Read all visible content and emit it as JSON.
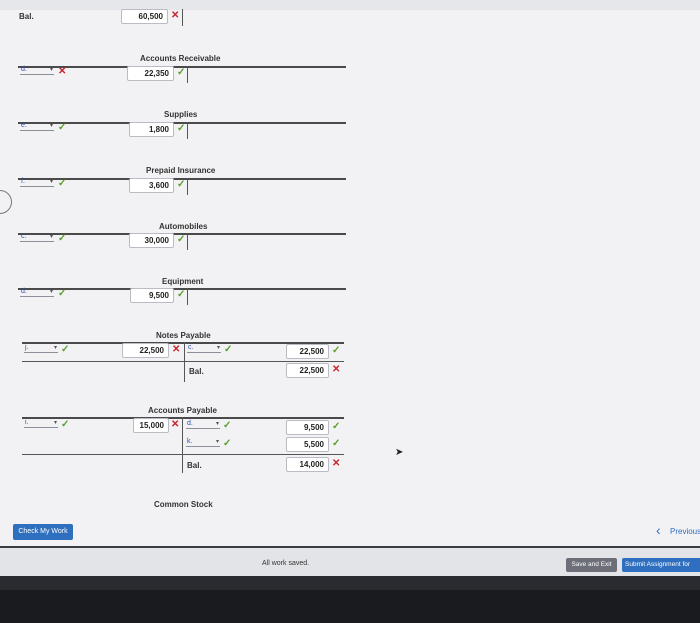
{
  "top": {
    "label": "Bal.",
    "value": "60,500"
  },
  "accounts": [
    {
      "title": "Accounts Receivable",
      "sel": "d.",
      "sel_mark": "✕",
      "value": "22,350",
      "val_mark": "✓"
    },
    {
      "title": "Supplies",
      "sel": "e.",
      "sel_mark": "✓",
      "value": "1,800",
      "val_mark": "✓"
    },
    {
      "title": "Prepaid Insurance",
      "sel": "f.",
      "sel_mark": "✓",
      "value": "3,600",
      "val_mark": "✓"
    },
    {
      "title": "Automobiles",
      "sel": "c.",
      "sel_mark": "✓",
      "value": "30,000",
      "val_mark": "✓"
    },
    {
      "title": "Equipment",
      "sel": "d.",
      "sel_mark": "✓",
      "value": "9,500",
      "val_mark": "✓"
    }
  ],
  "notes_payable": {
    "title": "Notes Payable",
    "left_sel": "j.",
    "left_value": "22,500",
    "right_sel": "c.",
    "right_value": "22,500",
    "bal_label": "Bal.",
    "bal_value": "22,500"
  },
  "accounts_payable": {
    "title": "Accounts Payable",
    "left_sel": "i.",
    "left_value": "15,000",
    "right_rows": [
      {
        "sel": "d.",
        "value": "9,500"
      },
      {
        "sel": "k.",
        "value": "5,500"
      }
    ],
    "bal_label": "Bal.",
    "bal_value": "14,000"
  },
  "common_stock": {
    "title": "Common Stock"
  },
  "buttons": {
    "check": "Check My Work",
    "previous": "Previous",
    "save": "Save and Exit",
    "submit": "Submit Assignment for"
  },
  "status": {
    "saved": "All work saved."
  },
  "colors": {
    "ok": "#5a9e2c",
    "bad": "#c8232c",
    "accent": "#2f6fbf"
  }
}
